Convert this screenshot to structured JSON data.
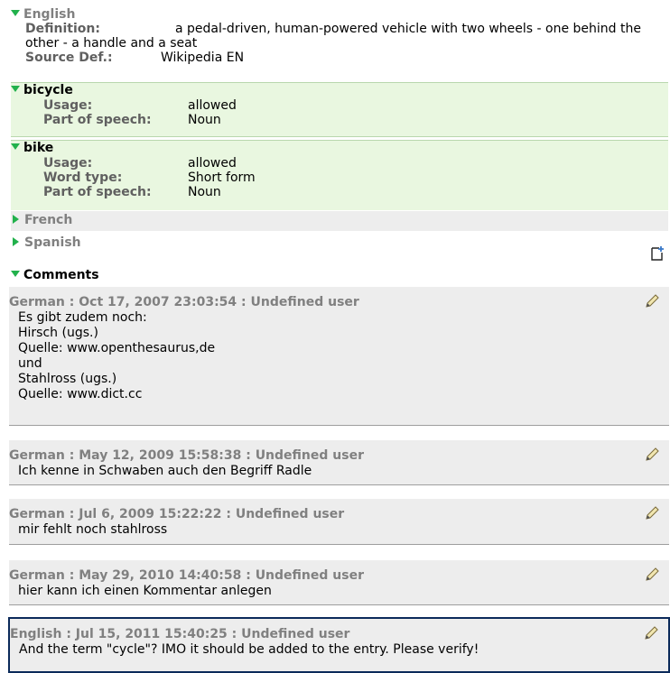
{
  "english": {
    "header": "English",
    "definition_label": "Definition:",
    "definition_text": "a pedal-driven, human-powered vehicle with two wheels - one behind the other - a handle and a seat",
    "source_label": "Source Def.:",
    "source_value": "Wikipedia EN",
    "terms": [
      {
        "name": "bicycle",
        "fields": [
          {
            "label": "Usage:",
            "value": "allowed"
          },
          {
            "label": "Part of speech:",
            "value": "Noun"
          }
        ]
      },
      {
        "name": "bike",
        "fields": [
          {
            "label": "Usage:",
            "value": "allowed"
          },
          {
            "label": "Word type:",
            "value": "Short form"
          },
          {
            "label": "Part of speech:",
            "value": "Noun"
          }
        ]
      }
    ]
  },
  "other_languages": [
    "French",
    "Spanish"
  ],
  "comments": {
    "header": "Comments",
    "items": [
      {
        "meta": "German : Oct 17, 2007 23:03:54 : Undefined user",
        "lines": [
          "Es gibt zudem noch:",
          "Hirsch (ugs.)",
          "Quelle: www.openthesaurus,de",
          "und",
          "Stahlross (ugs.)",
          "Quelle: www.dict.cc"
        ]
      },
      {
        "meta": "German : May 12, 2009 15:58:38 : Undefined user",
        "lines": [
          "Ich kenne in Schwaben auch den Begriff Radle"
        ]
      },
      {
        "meta": "German : Jul 6, 2009 15:22:22 : Undefined user",
        "lines": [
          "mir fehlt noch stahlross"
        ]
      },
      {
        "meta": "German : May 29, 2010 14:40:58 : Undefined user",
        "lines": [
          "hier kann ich einen Kommentar anlegen"
        ]
      },
      {
        "meta": "English : Jul 15, 2011 15:40:25 : Undefined user",
        "lines": [
          "And the term \"cycle\"? IMO it should be added to the entry. Please verify!"
        ]
      }
    ]
  },
  "icons": {
    "expand": "triangle-down-icon",
    "collapsed": "triangle-right-icon",
    "edit": "pencil-icon",
    "add_comment": "add-note-icon"
  },
  "colors": {
    "accent_green": "#22b14c",
    "term_background": "#e9f7e0",
    "comment_background": "#ededed",
    "selected_border": "#0b2a5a"
  }
}
